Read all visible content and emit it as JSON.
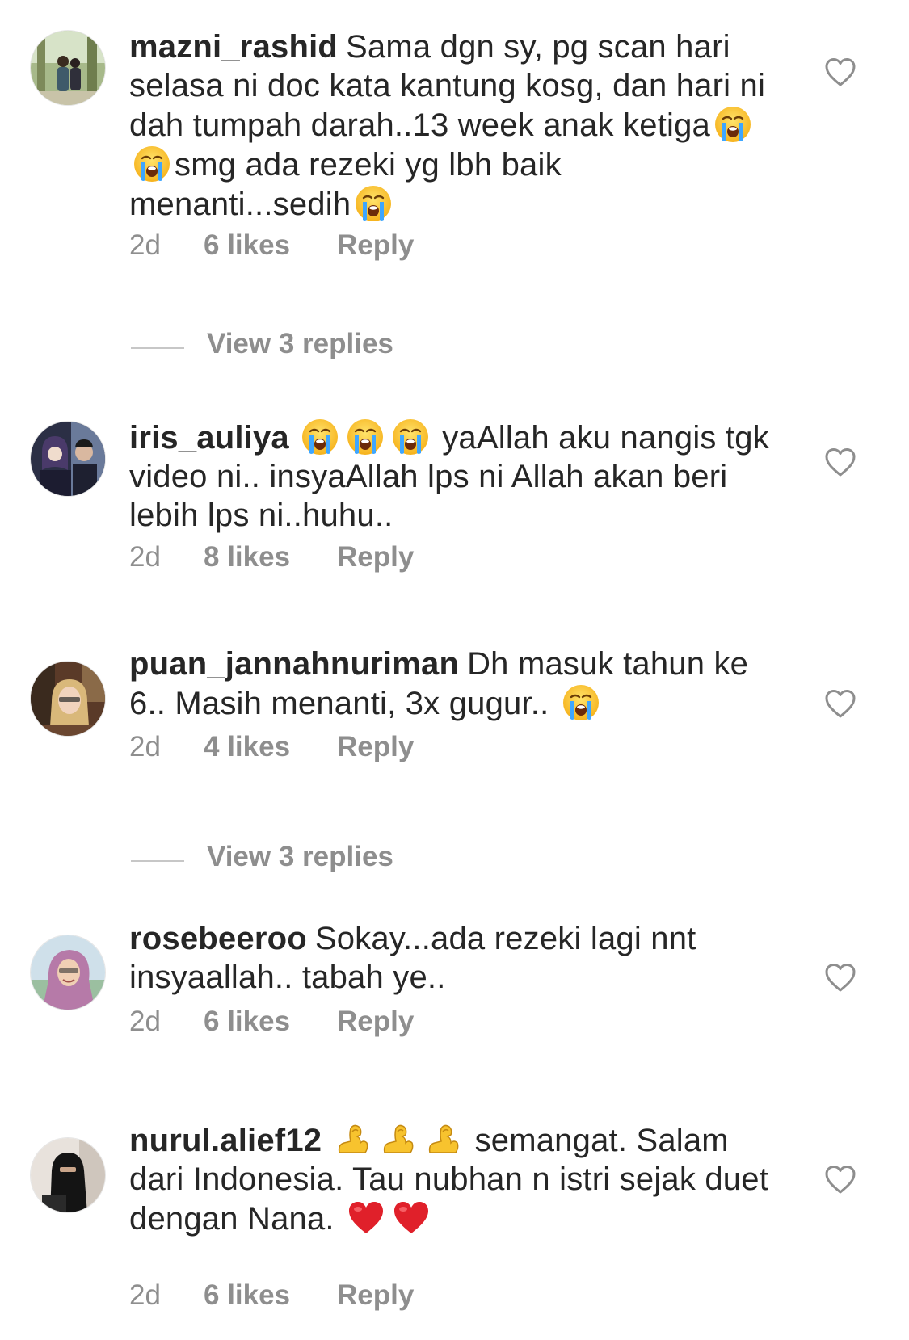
{
  "comments": [
    {
      "username": "mazni_rashid",
      "avatar_icon": "couple-outdoor-avatar",
      "text_parts": [
        "Sama dgn sy, pg scan hari selasa ni doc kata kantung kosg, dan hari ni dah tumpah darah..13 week anak ketiga",
        "smg ada rezeki yg lbh baik menanti...sedih",
        ""
      ],
      "emojis": [
        "loudly-crying-face",
        "loudly-crying-face",
        "loudly-crying-face"
      ],
      "time": "2d",
      "likes": "6 likes",
      "reply": "Reply",
      "view_replies": "View 3 replies"
    },
    {
      "username": "iris_auliya",
      "avatar_icon": "couple-dark-avatar",
      "text_parts": [
        "",
        "yaAllah aku nangis tgk video ni.. insyaAllah lps ni Allah akan beri lebih lps ni..huhu.."
      ],
      "emojis": [
        "loudly-crying-face",
        "loudly-crying-face",
        "loudly-crying-face"
      ],
      "time": "2d",
      "likes": "8 likes",
      "reply": "Reply"
    },
    {
      "username": "puan_jannahnuriman",
      "avatar_icon": "woman-hijab-avatar",
      "text_parts": [
        "Dh masuk tahun ke 6.. Masih menanti, 3x gugur..",
        ""
      ],
      "emojis": [
        "loudly-crying-face"
      ],
      "time": "2d",
      "likes": "4 likes",
      "reply": "Reply",
      "view_replies": "View 3 replies"
    },
    {
      "username": "rosebeeroo",
      "avatar_icon": "woman-purple-hijab-avatar",
      "text_parts": [
        "Sokay...ada rezeki lagi nnt insyaallah.. tabah ye.."
      ],
      "time": "2d",
      "likes": "6 likes",
      "reply": "Reply"
    },
    {
      "username": "nurul.alief12",
      "avatar_icon": "niqab-avatar",
      "text_parts": [
        "",
        "semangat. Salam dari Indonesia. Tau nubhan n istri sejak duet dengan Nana.",
        ""
      ],
      "emojis": [
        "flexed-biceps",
        "flexed-biceps",
        "flexed-biceps",
        "red-heart",
        "red-heart"
      ],
      "time": "2d",
      "likes": "6 likes",
      "reply": "Reply"
    }
  ],
  "colors": {
    "text": "#262626",
    "secondary": "#8e8e8e",
    "divider": "#c7c7c7",
    "heart_outline": "#8e8e8e"
  }
}
